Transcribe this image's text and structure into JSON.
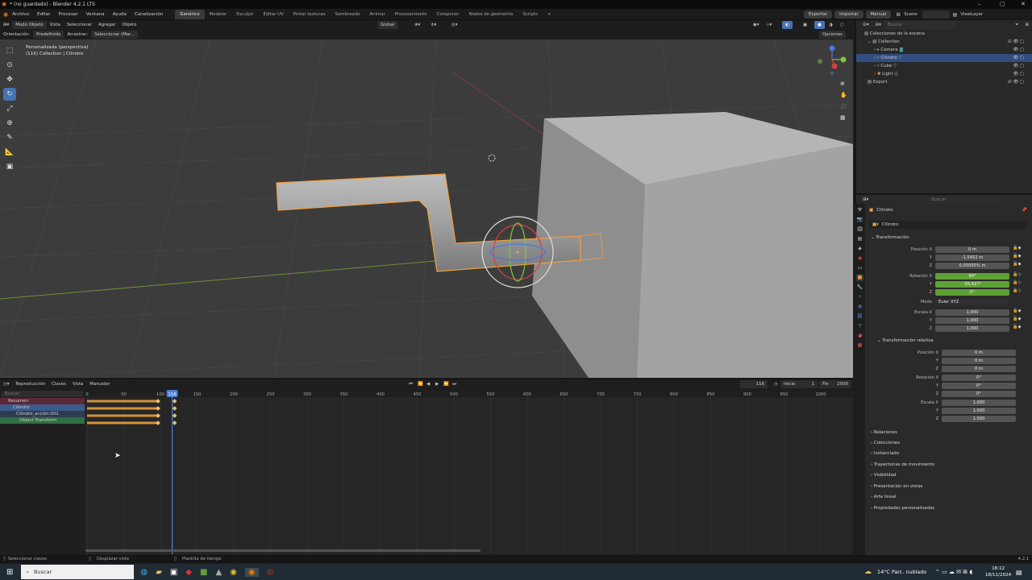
{
  "window": {
    "title": "* (no guardado) - Blender 4.2.1 LTS"
  },
  "menu": {
    "items": [
      "Archivo",
      "Editar",
      "Procesar",
      "Ventana",
      "Ayuda",
      "Canalización"
    ]
  },
  "workspaces": [
    "Genérico",
    "Modelar",
    "Esculpir",
    "Editar UV",
    "Pintar texturas",
    "Sombreado",
    "Animar",
    "Procesamiento",
    "Componer",
    "Nodos de geometría",
    "Scripts"
  ],
  "topright": {
    "export": "Exportar",
    "import": "Importar",
    "manual": "Manual",
    "scene": "Scene",
    "viewlayer": "ViewLayer"
  },
  "viewport_header": {
    "mode": "Modo Objeto",
    "view": "Vista",
    "select": "Seleccionar",
    "add": "Agregar",
    "object": "Objeto",
    "orientation": "Global"
  },
  "viewport_header2": {
    "orient_label": "Orientación:",
    "orient_value": "Predefinido",
    "drag_label": "Arrastrar:",
    "drag_value": "Seleccionar (Mar...",
    "options": "Opciones"
  },
  "viewport_info": {
    "line1": "Personalizada (perspectiva)",
    "line2": "(116) Collection | Cilindro"
  },
  "gizmo": {
    "x": "X",
    "y": "Y",
    "z": "Z"
  },
  "timeline_header": {
    "playback": "Reproducción",
    "keys": "Claves",
    "view": "Vista",
    "marker": "Marcador",
    "current": "116",
    "start_label": "Inicio",
    "start": "1",
    "end_label": "Fin",
    "end": "2000"
  },
  "timeline": {
    "search_placeholder": "Buscar",
    "channels": [
      {
        "label": "Resumen"
      },
      {
        "label": "Cilindro"
      },
      {
        "label": "Cilindro_acción.002"
      },
      {
        "label": "Object Transform"
      }
    ],
    "ruler": [
      "0",
      "50",
      "100",
      "150",
      "200",
      "250",
      "300",
      "350",
      "400",
      "450",
      "500",
      "550",
      "600",
      "650",
      "700",
      "750",
      "800",
      "850",
      "900",
      "950",
      "1000"
    ],
    "current_frame": "116"
  },
  "status": {
    "left": "Seleccionar claves",
    "middle": "Desplazar vista",
    "right": "Plantilla de tiempo",
    "version": "4.2.1"
  },
  "outliner": {
    "search_placeholder": "Buscar",
    "root": "Colecciones de la escena",
    "items": [
      {
        "label": "Collection",
        "depth": 0
      },
      {
        "label": "Camera",
        "depth": 1
      },
      {
        "label": "Cilindro",
        "depth": 1,
        "selected": true
      },
      {
        "label": "Cube",
        "depth": 1
      },
      {
        "label": "Light",
        "depth": 1
      },
      {
        "label": "Export",
        "depth": 0
      }
    ]
  },
  "properties": {
    "search_placeholder": "Buscar",
    "object_name": "Cilindro",
    "object_field": "Cilindro",
    "transform_title": "Transformación",
    "position_label": "Posición X",
    "position": [
      "0 m",
      "-1,5452 m",
      "0,05005% m"
    ],
    "rotation_label": "Rotación X",
    "rotation": [
      "90°",
      "-35,427°",
      "0°"
    ],
    "mode_label": "Modo",
    "mode_value": "Euler XYZ",
    "scale_label": "Escala X",
    "scale": [
      "1,000",
      "1,000",
      "1,000"
    ],
    "relative_title": "Transformación relativa",
    "rel_position": [
      "0 m",
      "0 m",
      "0 m"
    ],
    "rel_rotation": [
      "0°",
      "0°",
      "0°"
    ],
    "rel_scale": [
      "1,000",
      "1,000",
      "1,000"
    ],
    "axis_y": "Y",
    "axis_z": "Z",
    "sections": [
      "Relaciones",
      "Colecciones",
      "Instanciado",
      "Trayectorias de movimiento",
      "Visibilidad",
      "Presentación en vistas",
      "Arte lineal",
      "Propiedades personalizadas"
    ]
  },
  "taskbar": {
    "search_placeholder": "Buscar",
    "weather": "14°C Parc. nublado",
    "time": "18:12",
    "date": "18/11/2024"
  }
}
